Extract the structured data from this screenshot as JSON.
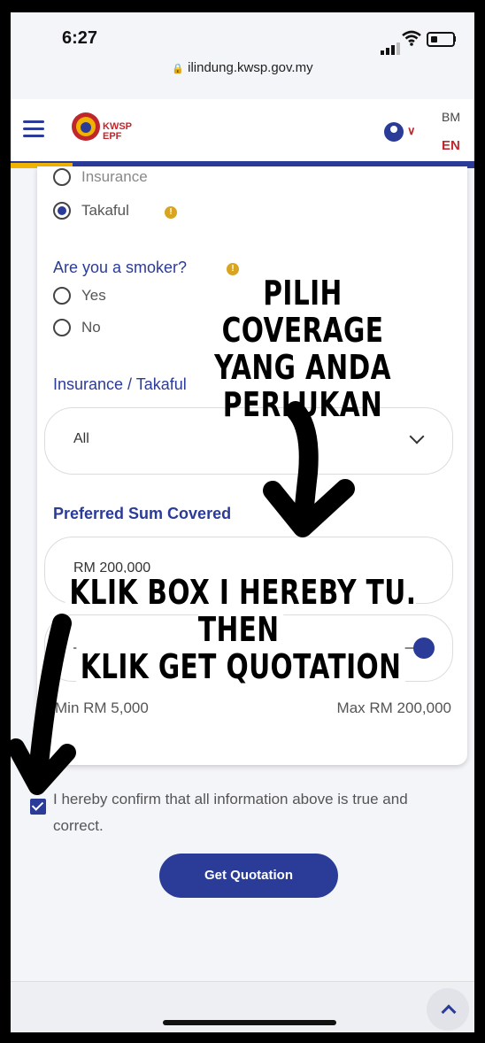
{
  "status_bar": {
    "time": "6:27",
    "url": "ilindung.kwsp.gov.my"
  },
  "header": {
    "logo_line1": "KWSP",
    "logo_line2": "EPF",
    "lang_bm": "BM",
    "lang_en": "EN"
  },
  "form": {
    "coverage_type": {
      "options": [
        "Insurance",
        "Takaful"
      ],
      "selected": "Takaful"
    },
    "smoker": {
      "question": "Are you a smoker?",
      "options": [
        "Yes",
        "No"
      ],
      "selected": null
    },
    "insurance_takaful": {
      "label": "Insurance / Takaful",
      "value": "All"
    },
    "sum_covered": {
      "label": "Preferred Sum Covered",
      "value": "RM 200,000",
      "min": "Min RM 5,000",
      "max": "Max RM 200,000",
      "slider_fraction": 1.0
    },
    "confirm_text": "I hereby confirm that all information above is true and correct.",
    "confirm_checked": true,
    "submit_label": "Get Quotation"
  },
  "annotations": {
    "top": [
      "PILIH COVERAGE",
      "YANG ANDA",
      "PERLUKAN"
    ],
    "bottom": [
      "KLIK BOX I HEREBY TU. THEN",
      "KLIK GET QUOTATION"
    ]
  },
  "colors": {
    "primary": "#2b3b98",
    "accent_red": "#c0272d",
    "info_yellow": "#d9a521"
  }
}
